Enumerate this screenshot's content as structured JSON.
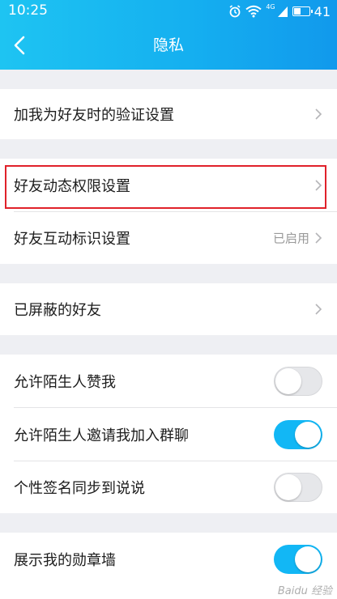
{
  "status_bar": {
    "time": "10:25",
    "network_tag": "4G",
    "battery": "41"
  },
  "header": {
    "title": "隐私"
  },
  "rows": {
    "verify": {
      "label": "加我为好友时的验证设置"
    },
    "moments": {
      "label": "好友动态权限设置"
    },
    "interaction": {
      "label": "好友互动标识设置",
      "status": "已启用"
    },
    "blocked": {
      "label": "已屏蔽的好友"
    },
    "stranger_like": {
      "label": "允许陌生人赞我",
      "on": false
    },
    "stranger_group": {
      "label": "允许陌生人邀请我加入群聊",
      "on": true
    },
    "signature_sync": {
      "label": "个性签名同步到说说",
      "on": false
    },
    "medal_wall": {
      "label": "展示我的勋章墙",
      "on": true
    }
  },
  "watermark": "Baidu 经验",
  "colors": {
    "accent": "#12b7f5",
    "highlight": "#e0212a"
  }
}
